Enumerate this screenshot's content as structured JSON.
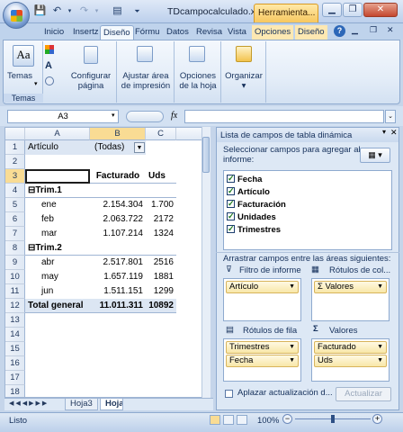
{
  "window": {
    "title": "TDcampocalculado.xlsx",
    "context_tab": "Herramienta..."
  },
  "tabs": [
    "Inicio",
    "Insertz",
    "Diseño",
    "Fórmu",
    "Datos",
    "Revisa",
    "Vista",
    "Opciones",
    "Diseño"
  ],
  "active_tab_index": 2,
  "ribbon": {
    "temas_label": "Temas",
    "group_temas": "Temas",
    "configurar_1": "Configurar",
    "configurar_2": "página",
    "ajustar_1": "Ajustar área",
    "ajustar_2": "de impresión",
    "opciones_1": "Opciones",
    "opciones_2": "de la hoja",
    "organizar": "Organizar"
  },
  "formula_bar": {
    "name_box": "A3",
    "fx": "fx",
    "value": ""
  },
  "columns": [
    "A",
    "B",
    "C"
  ],
  "rows": [
    {
      "n": "1",
      "a": "Artículo",
      "b": "(Todas)",
      "c": "",
      "style": "filter"
    },
    {
      "n": "2",
      "a": "",
      "b": "",
      "c": ""
    },
    {
      "n": "3",
      "a": "",
      "b": "Facturado",
      "c": "Uds",
      "style": "head"
    },
    {
      "n": "4",
      "a": "⊟Trim.1",
      "b": "",
      "c": "",
      "style": "group"
    },
    {
      "n": "5",
      "a": "ene",
      "b": "2.154.304",
      "c": "1.700",
      "style": "item"
    },
    {
      "n": "6",
      "a": "feb",
      "b": "2.063.722",
      "c": "2172",
      "style": "item"
    },
    {
      "n": "7",
      "a": "mar",
      "b": "1.107.214",
      "c": "1324",
      "style": "item"
    },
    {
      "n": "8",
      "a": "⊟Trim.2",
      "b": "",
      "c": "",
      "style": "group"
    },
    {
      "n": "9",
      "a": "abr",
      "b": "2.517.801",
      "c": "2516",
      "style": "item"
    },
    {
      "n": "10",
      "a": "may",
      "b": "1.657.119",
      "c": "1881",
      "style": "item"
    },
    {
      "n": "11",
      "a": "jun",
      "b": "1.511.151",
      "c": "1299",
      "style": "item"
    },
    {
      "n": "12",
      "a": "Total general",
      "b": "11.011.311",
      "c": "10892",
      "style": "total"
    },
    {
      "n": "13",
      "a": "",
      "b": "",
      "c": ""
    },
    {
      "n": "14",
      "a": "",
      "b": "",
      "c": ""
    },
    {
      "n": "15",
      "a": "",
      "b": "",
      "c": ""
    },
    {
      "n": "16",
      "a": "",
      "b": "",
      "c": ""
    },
    {
      "n": "17",
      "a": "",
      "b": "",
      "c": ""
    },
    {
      "n": "18",
      "a": "",
      "b": "",
      "c": ""
    }
  ],
  "sheet_tabs": [
    "Hoja3",
    "Hoja"
  ],
  "pivot_pane": {
    "title": "Lista de campos de tabla dinámica",
    "select_text_1": "Seleccionar campos para agregar al",
    "select_text_2": "informe:",
    "fields": [
      "Fecha",
      "Artículo",
      "Facturación",
      "Unidades",
      "Trimestres"
    ],
    "drag_text": "Arrastrar campos entre las áreas siguientes:",
    "report_filter_label": "Filtro de informe",
    "column_labels_label": "Rótulos de col...",
    "row_labels_label": "Rótulos de fila",
    "values_label": "Valores",
    "report_filter_items": [
      "Artículo"
    ],
    "column_items": [
      "Σ  Valores"
    ],
    "row_items": [
      "Trimestres",
      "Fecha"
    ],
    "value_items": [
      "Facturado",
      "Uds"
    ],
    "defer_label": "Aplazar actualización d...",
    "update_button": "Actualizar"
  },
  "status": {
    "text": "Listo",
    "zoom": "100%"
  }
}
